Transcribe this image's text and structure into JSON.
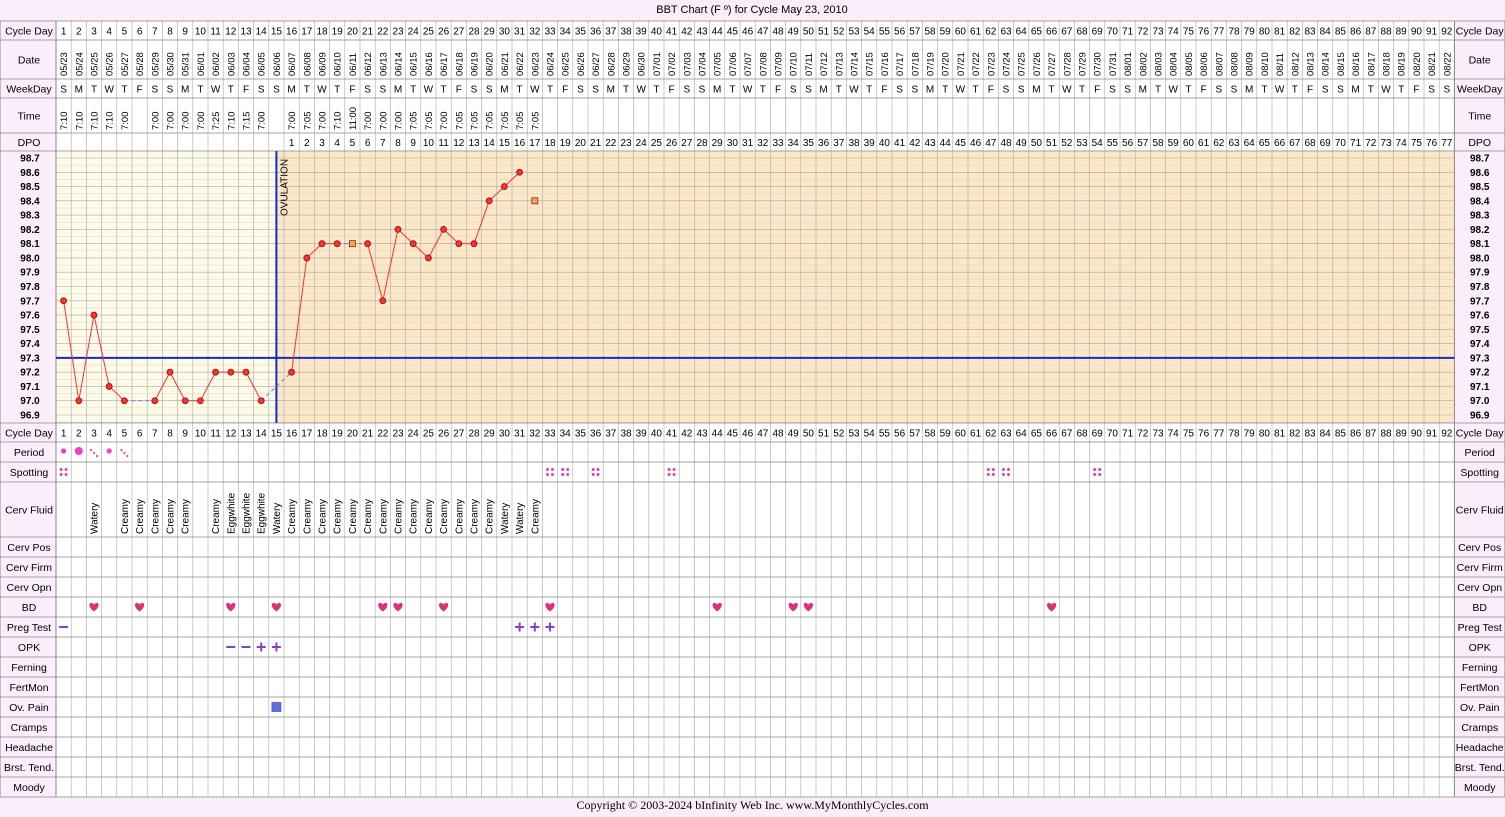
{
  "title": "BBT Chart (F º) for Cycle May 23, 2010",
  "copyright": "Copyright © 2003-2024 bInfinity Web Inc.     www.MyMonthlyCycles.com",
  "ovulation_label": "OVULATION",
  "colors": {
    "page_bg": "#fbeefb",
    "pre_ov_bg": "#fdfbe8",
    "post_ov_bg": "#fce8c6",
    "grid": "#a8a8a8",
    "temp_line": "#ff3030",
    "point_fill": "#ff3030",
    "coverline": "#1428c8",
    "heart": "#e0307a",
    "period": "#f040c0",
    "spotting": "#e040b0",
    "preg_test": "#8040d0",
    "ov_pain": "#6070e0"
  },
  "row_labels": {
    "cycle_day": "Cycle Day",
    "date": "Date",
    "weekday": "WeekDay",
    "time": "Time",
    "dpo": "DPO",
    "period": "Period",
    "spotting": "Spotting",
    "cerv_fluid": "Cerv Fluid",
    "cerv_pos": "Cerv Pos",
    "cerv_firm": "Cerv Firm",
    "cerv_opn": "Cerv Opn",
    "bd": "BD",
    "preg_test": "Preg Test",
    "opk": "OPK",
    "ferning": "Ferning",
    "fertmon": "FertMon",
    "ov_pain": "Ov. Pain",
    "cramps": "Cramps",
    "headache": "Headache",
    "brst_tend": "Brst. Tend.",
    "moody": "Moody"
  },
  "chart_data": {
    "type": "line",
    "title": "BBT Chart (F º) for Cycle May 23, 2010",
    "x_label": "Cycle Day",
    "y_label": "",
    "ylim": [
      96.9,
      98.7
    ],
    "y_ticks": [
      "98.7",
      "98.6",
      "98.5",
      "98.4",
      "98.3",
      "98.2",
      "98.1",
      "98.0",
      "97.9",
      "97.8",
      "97.7",
      "97.6",
      "97.5",
      "97.4",
      "97.3",
      "97.2",
      "97.1",
      "97.0",
      "96.9"
    ],
    "grid": true,
    "coverline": 97.3,
    "ovulation_day": 15,
    "cycle_days": [
      1,
      2,
      3,
      4,
      5,
      6,
      7,
      8,
      9,
      10,
      11,
      12,
      13,
      14,
      15,
      16,
      17,
      18,
      19,
      20,
      21,
      22,
      23,
      24,
      25,
      26,
      27,
      28,
      29,
      30,
      31,
      32,
      33,
      34,
      35,
      36,
      37,
      38,
      39,
      40,
      41,
      42,
      43,
      44,
      45,
      46,
      47,
      48,
      49,
      50,
      51,
      52,
      53,
      54,
      55,
      56,
      57,
      58,
      59,
      60,
      61,
      62,
      63,
      64,
      65,
      66,
      67,
      68,
      69,
      70,
      71,
      72,
      73,
      74,
      75,
      76,
      77,
      78,
      79,
      80,
      81,
      82,
      83,
      84,
      85,
      86,
      87,
      88,
      89,
      90,
      91,
      92
    ],
    "dates": [
      "05/23",
      "05/24",
      "05/25",
      "05/26",
      "05/27",
      "05/28",
      "05/29",
      "05/30",
      "05/31",
      "06/01",
      "06/02",
      "06/03",
      "06/04",
      "06/05",
      "06/06",
      "06/07",
      "06/08",
      "06/09",
      "06/10",
      "06/11",
      "06/12",
      "06/13",
      "06/14",
      "06/15",
      "06/16",
      "06/17",
      "06/18",
      "06/19",
      "06/20",
      "06/21",
      "06/22",
      "06/23",
      "06/24",
      "06/25",
      "06/26",
      "06/27",
      "06/28",
      "06/29",
      "06/30",
      "07/01",
      "07/02",
      "07/03",
      "07/04",
      "07/05",
      "07/06",
      "07/07",
      "07/08",
      "07/09",
      "07/10",
      "07/11",
      "07/12",
      "07/13",
      "07/14",
      "07/15",
      "07/16",
      "07/17",
      "07/18",
      "07/19",
      "07/20",
      "07/21",
      "07/22",
      "07/23",
      "07/24",
      "07/25",
      "07/26",
      "07/27",
      "07/28",
      "07/29",
      "07/30",
      "07/31",
      "08/01",
      "08/02",
      "08/03",
      "08/04",
      "08/05",
      "08/06",
      "08/07",
      "08/08",
      "08/09",
      "08/10",
      "08/11",
      "08/12",
      "08/13",
      "08/14",
      "08/15",
      "08/16",
      "08/17",
      "08/18",
      "08/19",
      "08/20",
      "08/21",
      "08/22"
    ],
    "weekdays": [
      "S",
      "M",
      "T",
      "W",
      "T",
      "F",
      "S",
      "S",
      "M",
      "T",
      "W",
      "T",
      "F",
      "S",
      "S",
      "M",
      "T",
      "W",
      "T",
      "F",
      "S",
      "S",
      "M",
      "T",
      "W",
      "T",
      "F",
      "S",
      "S",
      "M",
      "T",
      "W",
      "T",
      "F",
      "S",
      "S",
      "M",
      "T",
      "W",
      "T",
      "F",
      "S",
      "S",
      "M",
      "T",
      "W",
      "T",
      "F",
      "S",
      "S",
      "M",
      "T",
      "W",
      "T",
      "F",
      "S",
      "S",
      "M",
      "T",
      "W",
      "T",
      "F",
      "S",
      "S",
      "M",
      "T",
      "W",
      "T",
      "F",
      "S",
      "S",
      "M",
      "T",
      "W",
      "T",
      "F",
      "S",
      "S",
      "M",
      "T",
      "W",
      "T",
      "F",
      "S",
      "S",
      "M",
      "T",
      "W",
      "T",
      "F",
      "S",
      "S"
    ],
    "times": {
      "1": "7:10",
      "2": "7:10",
      "3": "7:10",
      "4": "7:10",
      "5": "7:00",
      "7": "7:00",
      "8": "7:00",
      "9": "7:00",
      "10": "7:00",
      "11": "7:25",
      "12": "7:10",
      "13": "7:15",
      "14": "7:00",
      "16": "7:00",
      "17": "7:05",
      "18": "7:00",
      "19": "7:10",
      "20": "11:00",
      "21": "7:00",
      "22": "7:00",
      "23": "7:00",
      "24": "7:05",
      "25": "7:05",
      "26": "7:00",
      "27": "7:05",
      "28": "7:05",
      "29": "7:05",
      "30": "7:05",
      "31": "7:05",
      "32": "7:05"
    },
    "dpo": [
      "1",
      "2",
      "3",
      "4",
      "5",
      "6",
      "7",
      "8",
      "9",
      "10",
      "11",
      "12",
      "13",
      "14",
      "15",
      "16",
      "17",
      "18",
      "19",
      "20",
      "21",
      "22",
      "23",
      "24",
      "25",
      "26",
      "27",
      "28",
      "29",
      "30",
      "31",
      "32",
      "33",
      "34",
      "35",
      "36",
      "37",
      "38",
      "39",
      "40",
      "41",
      "42",
      "43",
      "44",
      "45",
      "46",
      "47",
      "48",
      "49",
      "50",
      "51",
      "52",
      "53",
      "54",
      "55",
      "56",
      "57",
      "58",
      "59",
      "60",
      "61",
      "62",
      "63",
      "64",
      "65",
      "66",
      "67",
      "68",
      "69",
      "70",
      "71",
      "72",
      "73",
      "74",
      "75",
      "76",
      "77"
    ],
    "series": [
      {
        "points": [
          {
            "day": 1,
            "temp": 97.7
          },
          {
            "day": 2,
            "temp": 97.0
          },
          {
            "day": 3,
            "temp": 97.6
          },
          {
            "day": 4,
            "temp": 97.1
          },
          {
            "day": 5,
            "temp": 97.0
          },
          {
            "day": 7,
            "temp": 97.0
          },
          {
            "day": 8,
            "temp": 97.2
          },
          {
            "day": 9,
            "temp": 97.0
          },
          {
            "day": 10,
            "temp": 97.0
          },
          {
            "day": 11,
            "temp": 97.2
          },
          {
            "day": 12,
            "temp": 97.2
          },
          {
            "day": 13,
            "temp": 97.2
          },
          {
            "day": 14,
            "temp": 97.0
          },
          {
            "day": 16,
            "temp": 97.2
          },
          {
            "day": 17,
            "temp": 98.0
          },
          {
            "day": 18,
            "temp": 98.1
          },
          {
            "day": 19,
            "temp": 98.1
          },
          {
            "day": 21,
            "temp": 98.1
          },
          {
            "day": 22,
            "temp": 97.7
          },
          {
            "day": 23,
            "temp": 98.2
          },
          {
            "day": 24,
            "temp": 98.1
          },
          {
            "day": 25,
            "temp": 98.0
          },
          {
            "day": 26,
            "temp": 98.2
          },
          {
            "day": 27,
            "temp": 98.1
          },
          {
            "day": 28,
            "temp": 98.1
          },
          {
            "day": 29,
            "temp": 98.4
          },
          {
            "day": 30,
            "temp": 98.5
          },
          {
            "day": 31,
            "temp": 98.6
          }
        ],
        "excluded_points": [
          {
            "day": 20,
            "temp": 98.1
          },
          {
            "day": 32,
            "temp": 98.4
          }
        ]
      }
    ],
    "cerv_fluid": {
      "3": "Watery",
      "5": "Creamy",
      "6": "Creamy",
      "7": "Creamy",
      "8": "Creamy",
      "9": "Creamy",
      "11": "Creamy",
      "12": "Eggwhite",
      "13": "Eggwhite",
      "14": "Eggwhite",
      "15": "Watery",
      "16": "Creamy",
      "17": "Creamy",
      "18": "Creamy",
      "19": "Creamy",
      "20": "Creamy",
      "21": "Creamy",
      "22": "Creamy",
      "23": "Creamy",
      "24": "Creamy",
      "25": "Creamy",
      "26": "Creamy",
      "27": "Creamy",
      "28": "Creamy",
      "29": "Creamy",
      "30": "Watery",
      "31": "Watery",
      "32": "Creamy"
    },
    "period": {
      "1": "light",
      "2": "medium",
      "3": "spotting",
      "4": "light",
      "5": "spotting"
    },
    "spotting_days": [
      1,
      33,
      34,
      36,
      41,
      62,
      63,
      69
    ],
    "bd_days": [
      3,
      6,
      12,
      15,
      22,
      23,
      26,
      33,
      44,
      49,
      50,
      66
    ],
    "preg_test": {
      "1": "−",
      "31": "+",
      "32": "+",
      "33": "+"
    },
    "opk": {
      "12": "−",
      "13": "−",
      "14": "+",
      "15": "+"
    },
    "ov_pain_days": [
      15
    ]
  }
}
